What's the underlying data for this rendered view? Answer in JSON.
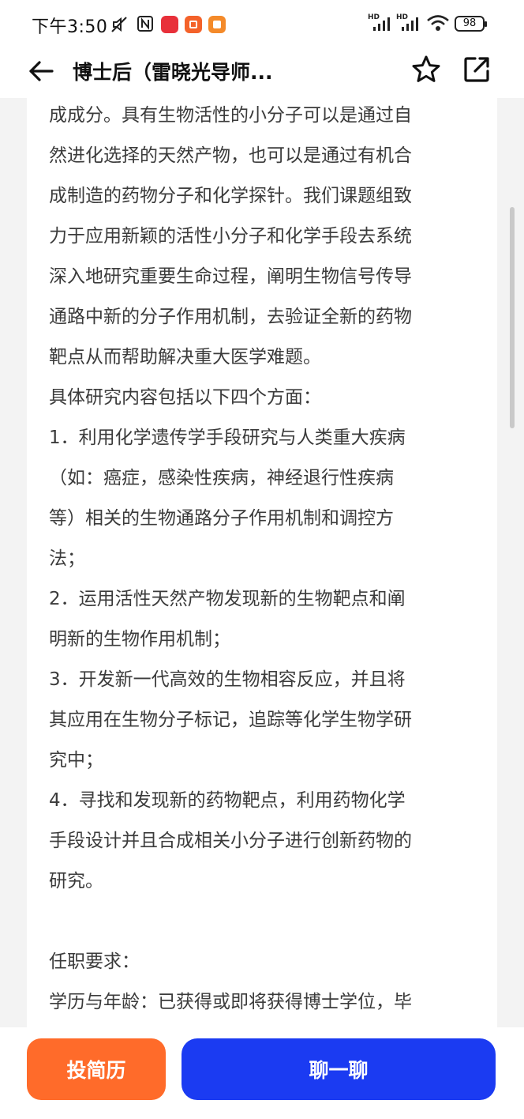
{
  "status_bar": {
    "time": "下午3:50",
    "network_1": "HD",
    "network_2": "HD",
    "battery": "98"
  },
  "header": {
    "title": "博士后（雷晓光导师..."
  },
  "job_description": {
    "lines": [
      "成成分。具有生物活性的小分子可以是通过自",
      "然进化选择的天然产物，也可以是通过有机合",
      "成制造的药物分子和化学探针。我们课题组致",
      "力于应用新颖的活性小分子和化学手段去系统",
      "深入地研究重要生命过程，阐明生物信号传导",
      "通路中新的分子作用机制，去验证全新的药物",
      "靶点从而帮助解决重大医学难题。",
      "具体研究内容包括以下四个方面：",
      "1．利用化学遗传学手段研究与人类重大疾病",
      "（如：癌症，感染性疾病，神经退行性疾病",
      "等）相关的生物通路分子作用机制和调控方",
      "法；",
      "2．运用活性天然产物发现新的生物靶点和阐",
      "明新的生物作用机制；",
      "3．开发新一代高效的生物相容反应，并且将",
      "其应用在生物分子标记，追踪等化学生物学研",
      "究中；",
      "4．寻找和发现新的药物靶点，利用药物化学",
      "手段设计并且合成相关小分子进行创新药物的",
      "研究。",
      "",
      "任职要求：",
      "学历与年龄：已获得或即将获得博士学位，毕"
    ]
  },
  "actions": {
    "resume_label": "投简历",
    "chat_label": "聊一聊"
  },
  "colors": {
    "resume_button": "#ff6b2a",
    "chat_button": "#1b3bf2"
  }
}
